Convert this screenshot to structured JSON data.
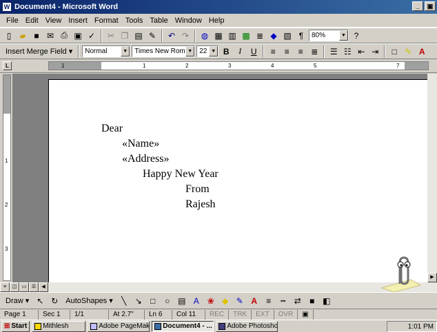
{
  "window": {
    "title": "Document4 - Microsoft Word",
    "min_glyph": "_",
    "restore_glyph": "▣"
  },
  "menu": [
    "File",
    "Edit",
    "View",
    "Insert",
    "Format",
    "Tools",
    "Table",
    "Window",
    "Help"
  ],
  "standard_toolbar": {
    "zoom": "80%",
    "help_glyph": "?"
  },
  "formatting_toolbar": {
    "merge_field": "Insert Merge Field ▾",
    "style": "Normal",
    "font": "Times New Roman",
    "size": "22",
    "bold": "B",
    "italic": "I",
    "underline": "U"
  },
  "ruler": {
    "corner": "L",
    "marks": [
      "1",
      "2",
      "3",
      "4",
      "5",
      "6",
      "7"
    ],
    "vmarks": [
      "1",
      "2",
      "3"
    ]
  },
  "document": {
    "lines": [
      "Dear",
      "«Name»",
      "«Address»",
      "Happy New Year",
      "From",
      "Rajesh"
    ]
  },
  "drawing_toolbar": {
    "draw": "Draw ▾",
    "autoshapes": "AutoShapes ▾"
  },
  "status": {
    "page": "Page 1",
    "sec": "Sec 1",
    "pages": "1/1",
    "at": "At 2.7\"",
    "ln": "Ln 6",
    "col": "Col 11",
    "rec": "REC",
    "trk": "TRK",
    "ext": "EXT",
    "ovr": "OVR"
  },
  "taskbar": {
    "start": "Start",
    "tasks": [
      "Mithlesh",
      "Adobe PageMak...",
      "Document4 - ...",
      "Adobe Photosho..."
    ],
    "clock": "1:01 PM"
  }
}
